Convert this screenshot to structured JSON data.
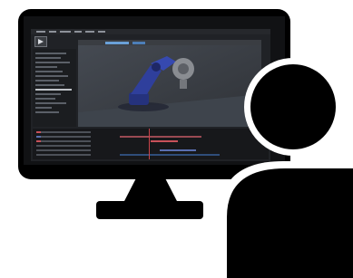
{
  "illustration": {
    "monitor_color": "#000000",
    "person_head_color": "#000000",
    "person_outline_color": "#ffffff"
  },
  "screen_app": {
    "icon": "video-editor-icon",
    "viewer": {
      "background": "#3b3f45",
      "icon": "3d-robot-arm-icon",
      "robot_color": "#2f3f9c",
      "robot_shadow": "#222533"
    },
    "timeline": {
      "track_colors": [
        "#9a4a52",
        "#c8515a",
        "#5a6fb0",
        "#2f4d7a"
      ]
    }
  }
}
